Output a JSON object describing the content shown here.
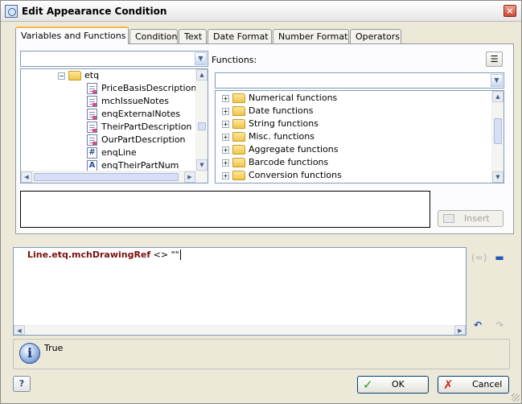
{
  "window": {
    "title": "Edit Appearance Condition",
    "close_glyph": "×"
  },
  "tabs": [
    {
      "label": "Variables and Functions",
      "active": true
    },
    {
      "label": "Condition"
    },
    {
      "label": "Text"
    },
    {
      "label": "Date Format"
    },
    {
      "label": "Number Format"
    },
    {
      "label": "Operators"
    }
  ],
  "variables": {
    "combo_value": "",
    "tree": {
      "folder": "etq",
      "items": [
        {
          "label": "PriceBasisDescription",
          "icon": "doc-icon"
        },
        {
          "label": "mchIssueNotes",
          "icon": "doc-icon"
        },
        {
          "label": "enqExternalNotes",
          "icon": "doc-icon"
        },
        {
          "label": "TheirPartDescription",
          "icon": "doc-icon"
        },
        {
          "label": "OurPartDescription",
          "icon": "doc-icon"
        },
        {
          "label": "enqLine",
          "icon": "number-icon",
          "glyph": "#"
        },
        {
          "label": "enqTheirPartNum",
          "icon": "text-icon",
          "glyph": "A"
        }
      ]
    }
  },
  "functions": {
    "label": "Functions:",
    "combo_value": "",
    "groups": [
      "Numerical functions",
      "Date functions",
      "String functions",
      "Misc. functions",
      "Aggregate functions",
      "Barcode functions",
      "Conversion functions"
    ]
  },
  "insert_label": "Insert",
  "editor": {
    "identifier": "Line.etq.mchDrawingRef",
    "rest": " <> \"\""
  },
  "result": {
    "text": "True"
  },
  "buttons": {
    "help": "?",
    "ok": "OK",
    "cancel": "Cancel"
  }
}
